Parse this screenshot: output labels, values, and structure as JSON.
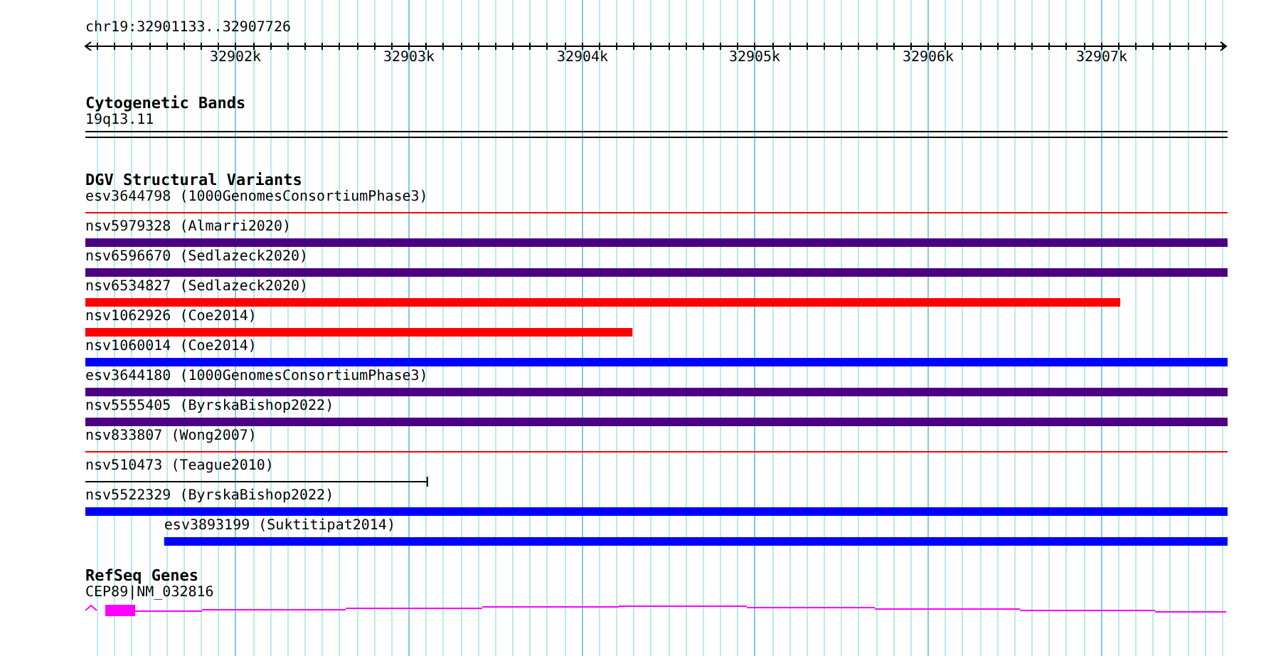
{
  "ruler": {
    "location": "chr19:32901133..32907726",
    "ticks": [
      "32902k",
      "32903k",
      "32904k",
      "32905k",
      "32906k",
      "32907k"
    ]
  },
  "cytogenetic_bands": {
    "title": "Cytogenetic Bands",
    "band": "19q13.11"
  },
  "dgv_structural_variants": {
    "title": "DGV Structural Variants",
    "variants": [
      {
        "label": "esv3644798 (1000GenomesConsortiumPhase3)",
        "kind": "line",
        "color": "#ff0000",
        "level": 1
      },
      {
        "label": "nsv5979328 (Almarri2020)",
        "kind": "bar",
        "color": "#4b0082",
        "level": 1
      },
      {
        "label": "nsv6596670 (Sedlazeck2020)",
        "kind": "bar",
        "color": "#4b0082",
        "level": 1
      },
      {
        "label": "nsv6534827 (Sedlazeck2020)",
        "kind": "bar",
        "color": "#ff0000",
        "level": 0.906
      },
      {
        "label": "nsv1062926 (Coe2014)",
        "kind": "bar",
        "color": "#ff0000",
        "level": 0.479
      },
      {
        "label": "nsv1060014 (Coe2014)",
        "kind": "bar",
        "color": "#0000ff",
        "level": 1
      },
      {
        "label": "esv3644180 (1000GenomesConsortiumPhase3)",
        "kind": "bar",
        "color": "#4b0082",
        "level": 1
      },
      {
        "label": "nsv5555405 (ByrskaBishop2022)",
        "kind": "bar",
        "color": "#4b0082",
        "level": 1
      },
      {
        "label": "nsv833807 (Wong2007)",
        "kind": "line",
        "color": "#ff0000",
        "level": 1
      },
      {
        "label": "nsv510473 (Teague2010)",
        "kind": "whisker",
        "color": "#000000",
        "level": 0.3
      },
      {
        "label": "nsv5522329 (ByrskaBishop2022)",
        "kind": "bar",
        "color": "#0000ff",
        "level": 1
      },
      {
        "label": "esv3893199 (Suktitipat2014)",
        "kind": "inset-bar",
        "color": "#0000ff",
        "level": 0.931
      }
    ]
  },
  "refseq_genes": {
    "title": "RefSeq Genes",
    "genes": [
      {
        "label": "CEP89|NM_032816",
        "color": "#ff00ff"
      }
    ]
  }
}
